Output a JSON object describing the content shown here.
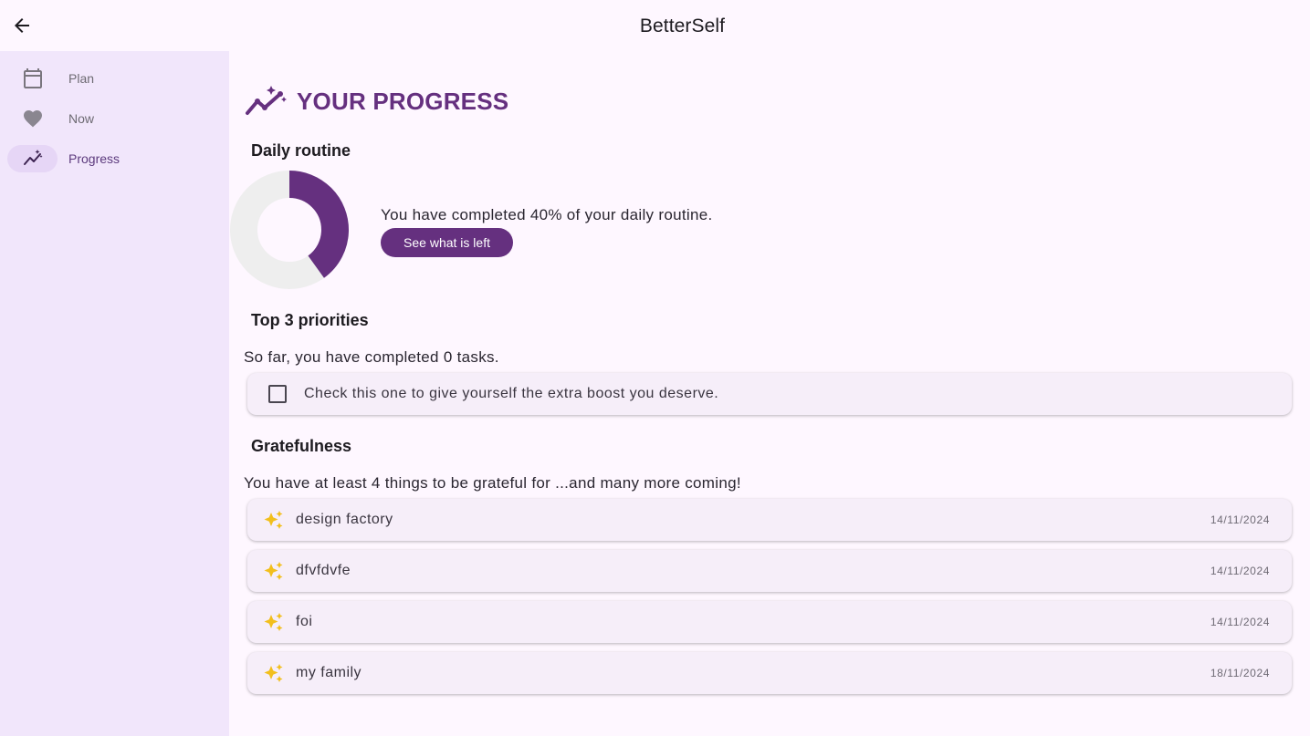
{
  "app": {
    "title": "BetterSelf"
  },
  "rail": {
    "items": [
      {
        "label": "Plan",
        "icon": "calendar-icon",
        "active": false
      },
      {
        "label": "Now",
        "icon": "heart-icon",
        "active": false
      },
      {
        "label": "Progress",
        "icon": "auto-graph-icon",
        "active": true
      }
    ]
  },
  "page": {
    "title": "YOUR PROGRESS",
    "icon": "auto-graph-icon"
  },
  "daily": {
    "title": "Daily routine",
    "percent": 40,
    "text": "You have completed 40% of your daily routine.",
    "button": "See what is left"
  },
  "priorities": {
    "title": "Top 3 priorities",
    "text": "So far, you have completed 0 tasks.",
    "task": {
      "label": "Check this one to give yourself the extra boost you deserve.",
      "checked": false
    }
  },
  "gratefulness": {
    "title": "Gratefulness",
    "text": "You have at least 4 things to be grateful for ...and many more coming!",
    "items": [
      {
        "label": "design factory",
        "date": "14/11/2024"
      },
      {
        "label": "dfvfdvfe",
        "date": "14/11/2024"
      },
      {
        "label": "foi",
        "date": "14/11/2024"
      },
      {
        "label": "my family",
        "date": "18/11/2024"
      }
    ]
  },
  "colors": {
    "accent": "#65307f",
    "background": "#fef7ff",
    "rail": "#f1e6fb",
    "card": "#f6eef9",
    "sparkle": "#f2bf1c",
    "donut_track": "#eeeeee"
  }
}
